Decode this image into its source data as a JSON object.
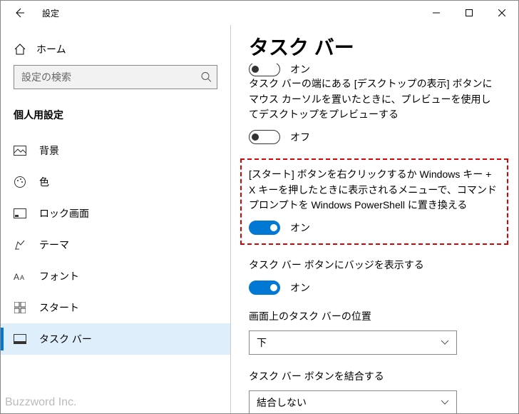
{
  "window": {
    "title": "設定"
  },
  "sidebar": {
    "home": "ホーム",
    "search_placeholder": "設定の検索",
    "section": "個人用設定",
    "items": [
      {
        "label": "背景"
      },
      {
        "label": "色"
      },
      {
        "label": "ロック画面"
      },
      {
        "label": "テーマ"
      },
      {
        "label": "フォント"
      },
      {
        "label": "スタート"
      },
      {
        "label": "タスク バー"
      }
    ]
  },
  "page": {
    "title": "タスク バー",
    "partial_toggle_label": "オン",
    "settings": [
      {
        "desc": "タスク バーの端にある [デスクトップの表示] ボタンにマウス カーソルを置いたときに、プレビューを使用してデスクトップをプレビューする",
        "state": "off",
        "state_label": "オフ"
      },
      {
        "desc": "[スタート] ボタンを右クリックするか Windows キー + X キーを押したときに表示されるメニューで、コマンド プロンプトを Windows PowerShell に置き換える",
        "state": "on",
        "state_label": "オン"
      },
      {
        "desc": "タスク バー ボタンにバッジを表示する",
        "state": "on",
        "state_label": "オン"
      }
    ],
    "position": {
      "label": "画面上のタスク バーの位置",
      "value": "下"
    },
    "combine": {
      "label": "タスク バー ボタンを結合する",
      "value": "結合しない"
    }
  },
  "watermark": "Buzzword Inc."
}
